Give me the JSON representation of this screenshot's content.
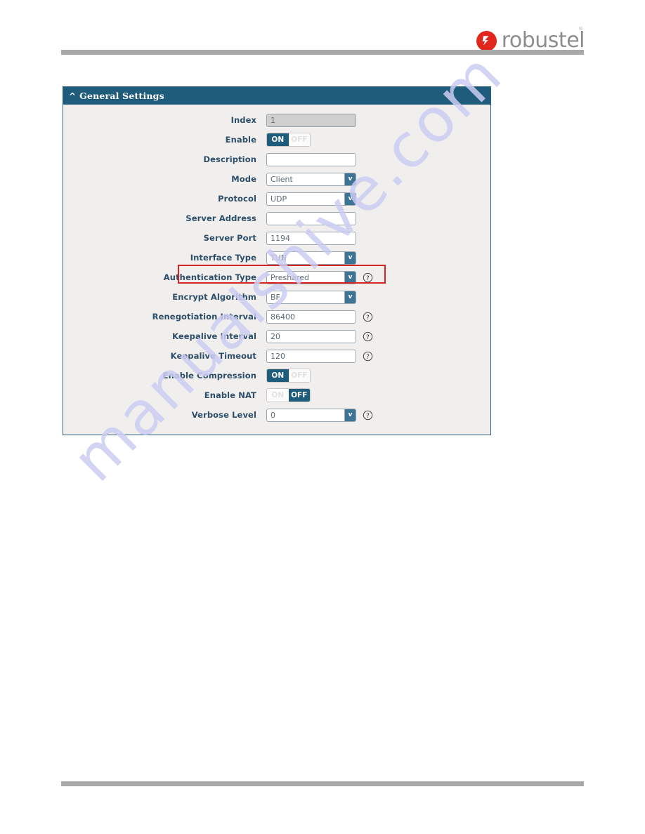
{
  "logo": {
    "icon": "robustel-logo-icon",
    "wordmark": "robustel",
    "trademark": "®",
    "mark_color": "#e1261c",
    "word_color": "#8d8d8d"
  },
  "watermark": {
    "text": "manualshive.com",
    "color": "#ccccf2"
  },
  "panel": {
    "collapse_icon": "chevron-up-icon",
    "title": "General Settings",
    "header_color": "#1f5b7a",
    "body_color": "#f0efee",
    "highlight_color": "#d42424"
  },
  "form": {
    "rows": [
      {
        "label": "Index",
        "type": "text",
        "value": "1",
        "disabled": true,
        "help": false,
        "highlight": false
      },
      {
        "label": "Enable",
        "type": "toggle",
        "value": "ON",
        "on_label": "ON",
        "off_label": "OFF",
        "help": false,
        "highlight": false
      },
      {
        "label": "Description",
        "type": "text",
        "value": "",
        "placeholder": "",
        "disabled": false,
        "help": false,
        "highlight": false
      },
      {
        "label": "Mode",
        "type": "select",
        "value": "Client",
        "help": false,
        "highlight": false
      },
      {
        "label": "Protocol",
        "type": "select",
        "value": "UDP",
        "help": false,
        "highlight": false
      },
      {
        "label": "Server Address",
        "type": "text",
        "value": "",
        "placeholder": "",
        "disabled": false,
        "help": false,
        "highlight": false
      },
      {
        "label": "Server Port",
        "type": "text",
        "value": "1194",
        "disabled": false,
        "help": false,
        "highlight": false
      },
      {
        "label": "Interface Type",
        "type": "select",
        "value": "TUN",
        "help": false,
        "highlight": false
      },
      {
        "label": "Authentication Type",
        "type": "select",
        "value": "Preshared",
        "help": true,
        "highlight": true
      },
      {
        "label": "Encrypt Algorithm",
        "type": "select",
        "value": "BF",
        "help": false,
        "highlight": false
      },
      {
        "label": "Renegotiation Interval",
        "type": "text",
        "value": "86400",
        "disabled": false,
        "help": true,
        "highlight": false
      },
      {
        "label": "Keepalive Interval",
        "type": "text",
        "value": "20",
        "disabled": false,
        "help": true,
        "highlight": false
      },
      {
        "label": "Keepalive Timeout",
        "type": "text",
        "value": "120",
        "disabled": false,
        "help": true,
        "highlight": false
      },
      {
        "label": "Enable Compression",
        "type": "toggle",
        "value": "ON",
        "on_label": "ON",
        "off_label": "OFF",
        "help": false,
        "highlight": false
      },
      {
        "label": "Enable NAT",
        "type": "toggle",
        "value": "OFF",
        "on_label": "ON",
        "off_label": "OFF",
        "help": false,
        "highlight": false
      },
      {
        "label": "Verbose Level",
        "type": "select",
        "value": "0",
        "help": true,
        "highlight": false
      }
    ]
  }
}
